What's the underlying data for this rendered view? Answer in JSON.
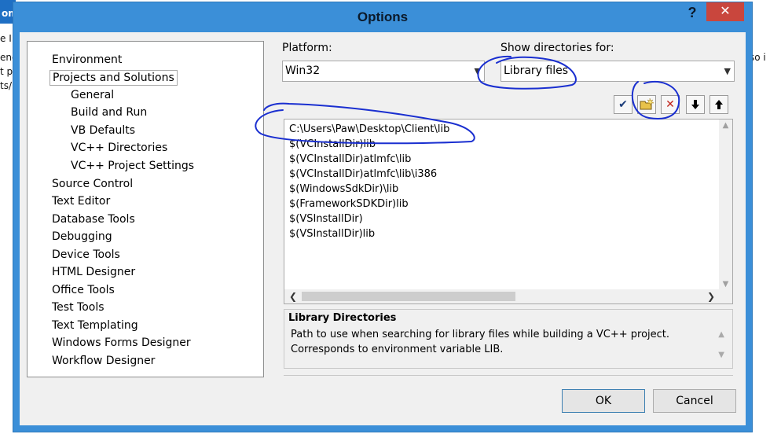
{
  "background": {
    "left_bar_text": "om",
    "left_lines": [
      "e I",
      "ene",
      "t pa",
      "ts/l"
    ],
    "right_text": "so i"
  },
  "dialog": {
    "title": "Options",
    "help_label": "?",
    "close_label": "✕"
  },
  "tree": {
    "items": [
      {
        "label": "Environment",
        "level": 0
      },
      {
        "label": "Projects and Solutions",
        "level": 0
      },
      {
        "label": "General",
        "level": 1
      },
      {
        "label": "Build and Run",
        "level": 1
      },
      {
        "label": "VB Defaults",
        "level": 1
      },
      {
        "label": "VC++ Directories",
        "level": 1
      },
      {
        "label": "VC++ Project Settings",
        "level": 1
      },
      {
        "label": "Source Control",
        "level": 0
      },
      {
        "label": "Text Editor",
        "level": 0
      },
      {
        "label": "Database Tools",
        "level": 0
      },
      {
        "label": "Debugging",
        "level": 0
      },
      {
        "label": "Device Tools",
        "level": 0
      },
      {
        "label": "HTML Designer",
        "level": 0
      },
      {
        "label": "Office Tools",
        "level": 0
      },
      {
        "label": "Test Tools",
        "level": 0
      },
      {
        "label": "Text Templating",
        "level": 0
      },
      {
        "label": "Windows Forms Designer",
        "level": 0
      },
      {
        "label": "Workflow Designer",
        "level": 0
      }
    ]
  },
  "platform": {
    "label": "Platform:",
    "value": "Win32"
  },
  "show_dirs": {
    "label": "Show directories for:",
    "value": "Library files"
  },
  "toolbar": {
    "check_icon": "checkmark-icon",
    "new_folder_icon": "new-folder-icon",
    "delete_icon": "delete-x-icon",
    "move_down_icon": "arrow-down-icon",
    "move_up_icon": "arrow-up-icon",
    "check_glyph": "✔",
    "down_glyph": "🡇",
    "up_glyph": "🡅",
    "delete_glyph": "✕"
  },
  "directories": [
    "C:\\Users\\Paw\\Desktop\\Client\\lib",
    "$(VCInstallDir)lib",
    "$(VCInstallDir)atlmfc\\lib",
    "$(VCInstallDir)atlmfc\\lib\\i386",
    "$(WindowsSdkDir)\\lib",
    "$(FrameworkSDKDir)lib",
    "$(VSInstallDir)",
    "$(VSInstallDir)lib"
  ],
  "description": {
    "title": "Library Directories",
    "body": "Path to use when searching for library files while building a VC++ project. Corresponds to environment variable LIB."
  },
  "buttons": {
    "ok": "OK",
    "cancel": "Cancel"
  },
  "colors": {
    "title_bar": "#3b8fd8",
    "close_button": "#c9463d",
    "annotation_ink": "#1a2fd0"
  }
}
